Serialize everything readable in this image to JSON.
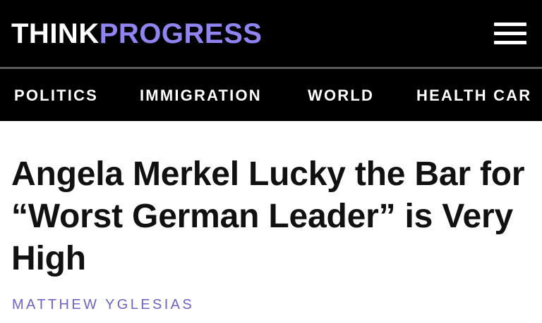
{
  "header": {
    "logo_part1": "THINK",
    "logo_part2": "PROGRESS",
    "menu_icon": "hamburger-menu-icon"
  },
  "nav": {
    "items": [
      {
        "label": "POLITICS"
      },
      {
        "label": "IMMIGRATION"
      },
      {
        "label": "WORLD"
      },
      {
        "label": "HEALTH CAR"
      }
    ]
  },
  "article": {
    "headline": "Angela Merkel Lucky the Bar for “Worst German Leader” is Very High",
    "author": "MATTHEW YGLESIAS"
  },
  "colors": {
    "header_background": "#000000",
    "logo_accent": "#8f84f1",
    "byline": "#6c64c9",
    "headline_text": "#111111"
  }
}
